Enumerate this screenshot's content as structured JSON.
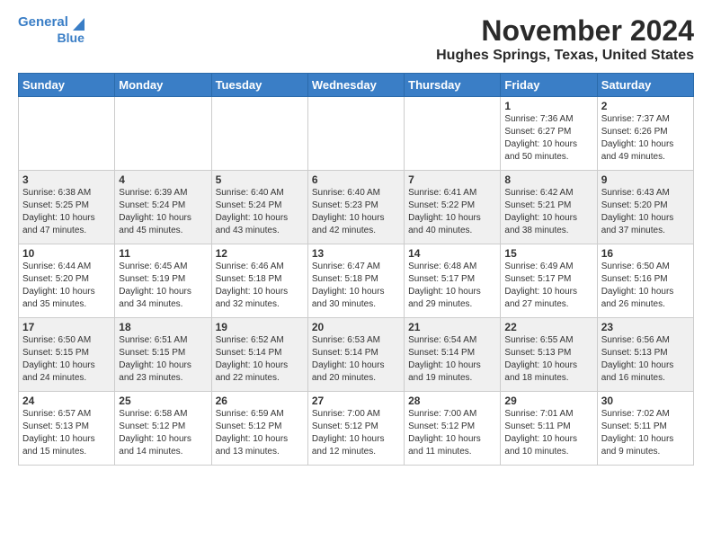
{
  "header": {
    "logo_line1": "General",
    "logo_line2": "Blue",
    "title": "November 2024",
    "subtitle": "Hughes Springs, Texas, United States"
  },
  "weekdays": [
    "Sunday",
    "Monday",
    "Tuesday",
    "Wednesday",
    "Thursday",
    "Friday",
    "Saturday"
  ],
  "weeks": [
    [
      {
        "day": "",
        "detail": ""
      },
      {
        "day": "",
        "detail": ""
      },
      {
        "day": "",
        "detail": ""
      },
      {
        "day": "",
        "detail": ""
      },
      {
        "day": "",
        "detail": ""
      },
      {
        "day": "1",
        "detail": "Sunrise: 7:36 AM\nSunset: 6:27 PM\nDaylight: 10 hours\nand 50 minutes."
      },
      {
        "day": "2",
        "detail": "Sunrise: 7:37 AM\nSunset: 6:26 PM\nDaylight: 10 hours\nand 49 minutes."
      }
    ],
    [
      {
        "day": "3",
        "detail": "Sunrise: 6:38 AM\nSunset: 5:25 PM\nDaylight: 10 hours\nand 47 minutes."
      },
      {
        "day": "4",
        "detail": "Sunrise: 6:39 AM\nSunset: 5:24 PM\nDaylight: 10 hours\nand 45 minutes."
      },
      {
        "day": "5",
        "detail": "Sunrise: 6:40 AM\nSunset: 5:24 PM\nDaylight: 10 hours\nand 43 minutes."
      },
      {
        "day": "6",
        "detail": "Sunrise: 6:40 AM\nSunset: 5:23 PM\nDaylight: 10 hours\nand 42 minutes."
      },
      {
        "day": "7",
        "detail": "Sunrise: 6:41 AM\nSunset: 5:22 PM\nDaylight: 10 hours\nand 40 minutes."
      },
      {
        "day": "8",
        "detail": "Sunrise: 6:42 AM\nSunset: 5:21 PM\nDaylight: 10 hours\nand 38 minutes."
      },
      {
        "day": "9",
        "detail": "Sunrise: 6:43 AM\nSunset: 5:20 PM\nDaylight: 10 hours\nand 37 minutes."
      }
    ],
    [
      {
        "day": "10",
        "detail": "Sunrise: 6:44 AM\nSunset: 5:20 PM\nDaylight: 10 hours\nand 35 minutes."
      },
      {
        "day": "11",
        "detail": "Sunrise: 6:45 AM\nSunset: 5:19 PM\nDaylight: 10 hours\nand 34 minutes."
      },
      {
        "day": "12",
        "detail": "Sunrise: 6:46 AM\nSunset: 5:18 PM\nDaylight: 10 hours\nand 32 minutes."
      },
      {
        "day": "13",
        "detail": "Sunrise: 6:47 AM\nSunset: 5:18 PM\nDaylight: 10 hours\nand 30 minutes."
      },
      {
        "day": "14",
        "detail": "Sunrise: 6:48 AM\nSunset: 5:17 PM\nDaylight: 10 hours\nand 29 minutes."
      },
      {
        "day": "15",
        "detail": "Sunrise: 6:49 AM\nSunset: 5:17 PM\nDaylight: 10 hours\nand 27 minutes."
      },
      {
        "day": "16",
        "detail": "Sunrise: 6:50 AM\nSunset: 5:16 PM\nDaylight: 10 hours\nand 26 minutes."
      }
    ],
    [
      {
        "day": "17",
        "detail": "Sunrise: 6:50 AM\nSunset: 5:15 PM\nDaylight: 10 hours\nand 24 minutes."
      },
      {
        "day": "18",
        "detail": "Sunrise: 6:51 AM\nSunset: 5:15 PM\nDaylight: 10 hours\nand 23 minutes."
      },
      {
        "day": "19",
        "detail": "Sunrise: 6:52 AM\nSunset: 5:14 PM\nDaylight: 10 hours\nand 22 minutes."
      },
      {
        "day": "20",
        "detail": "Sunrise: 6:53 AM\nSunset: 5:14 PM\nDaylight: 10 hours\nand 20 minutes."
      },
      {
        "day": "21",
        "detail": "Sunrise: 6:54 AM\nSunset: 5:14 PM\nDaylight: 10 hours\nand 19 minutes."
      },
      {
        "day": "22",
        "detail": "Sunrise: 6:55 AM\nSunset: 5:13 PM\nDaylight: 10 hours\nand 18 minutes."
      },
      {
        "day": "23",
        "detail": "Sunrise: 6:56 AM\nSunset: 5:13 PM\nDaylight: 10 hours\nand 16 minutes."
      }
    ],
    [
      {
        "day": "24",
        "detail": "Sunrise: 6:57 AM\nSunset: 5:13 PM\nDaylight: 10 hours\nand 15 minutes."
      },
      {
        "day": "25",
        "detail": "Sunrise: 6:58 AM\nSunset: 5:12 PM\nDaylight: 10 hours\nand 14 minutes."
      },
      {
        "day": "26",
        "detail": "Sunrise: 6:59 AM\nSunset: 5:12 PM\nDaylight: 10 hours\nand 13 minutes."
      },
      {
        "day": "27",
        "detail": "Sunrise: 7:00 AM\nSunset: 5:12 PM\nDaylight: 10 hours\nand 12 minutes."
      },
      {
        "day": "28",
        "detail": "Sunrise: 7:00 AM\nSunset: 5:12 PM\nDaylight: 10 hours\nand 11 minutes."
      },
      {
        "day": "29",
        "detail": "Sunrise: 7:01 AM\nSunset: 5:11 PM\nDaylight: 10 hours\nand 10 minutes."
      },
      {
        "day": "30",
        "detail": "Sunrise: 7:02 AM\nSunset: 5:11 PM\nDaylight: 10 hours\nand 9 minutes."
      }
    ]
  ]
}
